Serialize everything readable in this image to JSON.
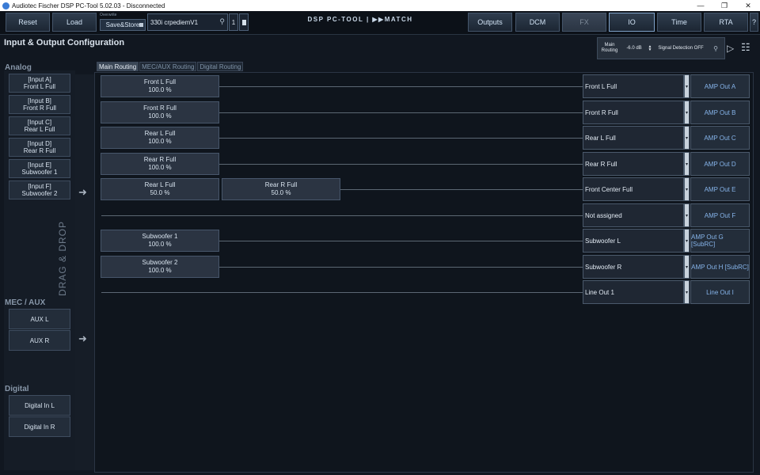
{
  "window": {
    "title": "Audiotec Fischer DSP PC-Tool 5.02.03 - Disconnected"
  },
  "toolbar": {
    "reset": "Reset",
    "load": "Load",
    "overwrite": "Overwrite",
    "save_store": "Save&Store",
    "preset_name": "330i crpediemV1",
    "preset_number": "1",
    "logo": "DSP PC-TOOL | ▶▶MATCH",
    "outputs": "Outputs",
    "dcm": "DCM",
    "fx": "FX",
    "io": "IO",
    "time": "Time",
    "rta": "RTA",
    "help": "?"
  },
  "page": {
    "title": "Input & Output Configuration",
    "main_volume": {
      "label_line1": "Main",
      "label_line2": "Routing",
      "value": "-6.0 dB",
      "signal_detection": "Signal Detection OFF"
    }
  },
  "sidebar": {
    "analog_title": "Analog",
    "analog_inputs": [
      {
        "line1": "[Input A]",
        "line2": "Front L Full"
      },
      {
        "line1": "[Input B]",
        "line2": "Front R Full"
      },
      {
        "line1": "[Input C]",
        "line2": "Rear L Full"
      },
      {
        "line1": "[Input D]",
        "line2": "Rear R Full"
      },
      {
        "line1": "[Input E]",
        "line2": "Subwoofer 1"
      },
      {
        "line1": "[Input F]",
        "line2": "Subwoofer 2"
      }
    ],
    "mec_title": "MEC / AUX",
    "mec_inputs": [
      "AUX L",
      "AUX R"
    ],
    "digital_title": "Digital",
    "digital_inputs": [
      "Digital In L",
      "Digital In R"
    ],
    "drag_drop": "DRAG & DROP"
  },
  "tabs": [
    "Main Routing",
    "MEC/AUX Routing",
    "Digital Routing"
  ],
  "routing": {
    "rows": [
      {
        "sources": [
          {
            "name": "Front L Full",
            "level": "100.0 %"
          }
        ],
        "output_name": "Front L Full",
        "amp_out": "AMP Out A"
      },
      {
        "sources": [
          {
            "name": "Front R Full",
            "level": "100.0 %"
          }
        ],
        "output_name": "Front R Full",
        "amp_out": "AMP Out B"
      },
      {
        "sources": [
          {
            "name": "Rear L Full",
            "level": "100.0 %"
          }
        ],
        "output_name": "Rear L Full",
        "amp_out": "AMP Out C"
      },
      {
        "sources": [
          {
            "name": "Rear R Full",
            "level": "100.0 %"
          }
        ],
        "output_name": "Rear R Full",
        "amp_out": "AMP Out D"
      },
      {
        "sources": [
          {
            "name": "Rear L Full",
            "level": "50.0 %"
          },
          {
            "name": "Rear R Full",
            "level": "50.0 %"
          }
        ],
        "output_name": "Front Center Full",
        "amp_out": "AMP Out E"
      },
      {
        "sources": [],
        "output_name": "Not assigned",
        "amp_out": "AMP Out F"
      },
      {
        "sources": [
          {
            "name": "Subwoofer 1",
            "level": "100.0 %"
          }
        ],
        "output_name": "Subwoofer L",
        "amp_out": "AMP Out G [SubRC]"
      },
      {
        "sources": [
          {
            "name": "Subwoofer 2",
            "level": "100.0 %"
          }
        ],
        "output_name": "Subwoofer R",
        "amp_out": "AMP Out H [SubRC]"
      },
      {
        "sources": [],
        "output_name": "Line Out 1",
        "amp_out": "Line Out I"
      }
    ]
  }
}
